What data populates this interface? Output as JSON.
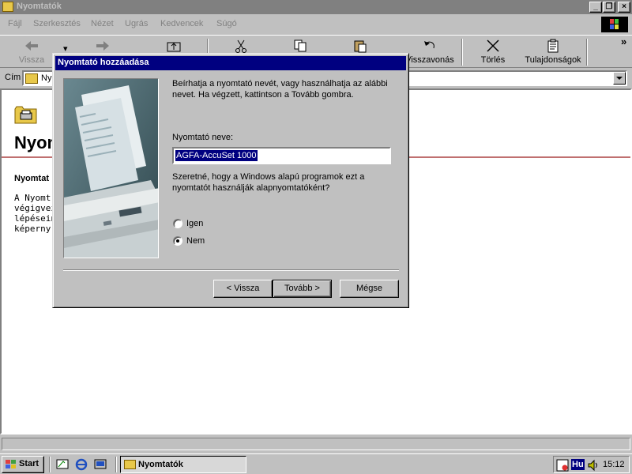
{
  "window": {
    "title": "Nyomtatók"
  },
  "menu": {
    "items": [
      {
        "label": "Fájl"
      },
      {
        "label": "Szerkesztés"
      },
      {
        "label": "Nézet"
      },
      {
        "label": "Ugrás"
      },
      {
        "label": "Kedvencek"
      },
      {
        "label": "Súgó"
      }
    ]
  },
  "toolbar": {
    "back": "Vissza",
    "undo": "Visszavonás",
    "delete": "Törlés",
    "properties": "Tulajdonságok",
    "more": "»"
  },
  "address": {
    "label": "Cím",
    "value": "Ny"
  },
  "content": {
    "title": "Nyom",
    "subtitle": "Nyomtat",
    "body": "A Nyomt végigvez lépésein képerny"
  },
  "dialog": {
    "title": "Nyomtató hozzáadása",
    "intro": "Beírhatja a nyomtató nevét, vagy használhatja az alábbi nevet. Ha végzett, kattintson a Tovább gombra.",
    "name_label": "Nyomtató neve:",
    "name_value": "AGFA-AccuSet 1000",
    "question": "Szeretné, hogy a Windows alapú programok ezt a nyomtatót használják alapnyomtatóként?",
    "option_yes": "Igen",
    "option_no": "Nem",
    "selected": "Nem",
    "btn_back": "< Vissza",
    "btn_next": "Tovább >",
    "btn_cancel": "Mégse"
  },
  "taskbar": {
    "start": "Start",
    "task": "Nyomtatók",
    "lang": "Hu",
    "clock": "15:12"
  },
  "colors": {
    "dialog_title": "#000080",
    "face": "#c0c0c0",
    "selection": "#000080"
  }
}
